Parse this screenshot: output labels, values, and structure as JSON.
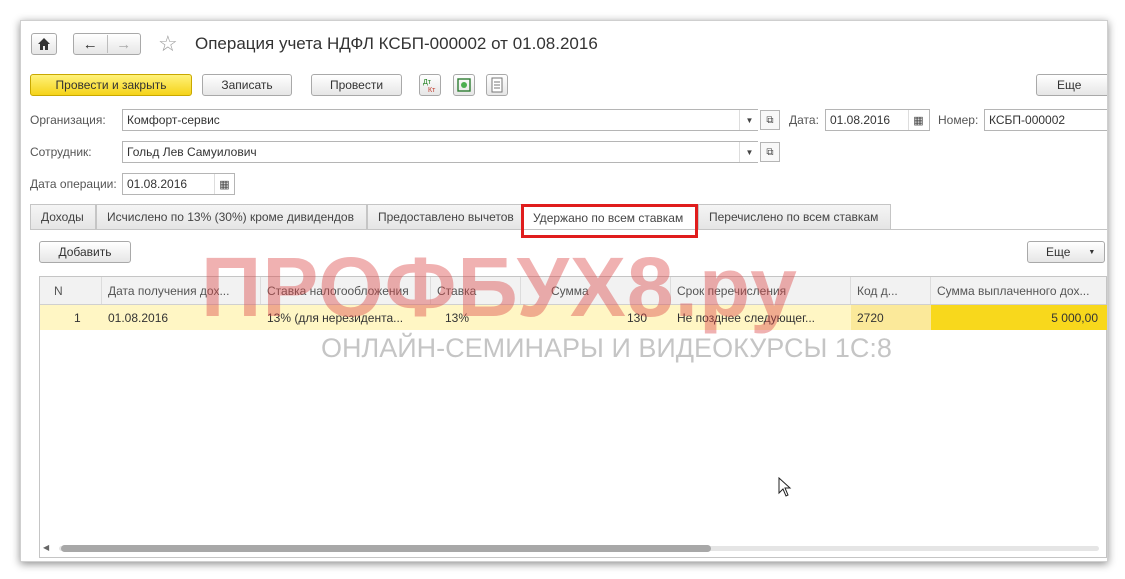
{
  "header": {
    "title": "Операция учета НДФЛ КСБП-000002 от 01.08.2016"
  },
  "toolbar": {
    "post_close": "Провести и закрыть",
    "save": "Записать",
    "post": "Провести",
    "more": "Еще"
  },
  "form": {
    "org_label": "Организация:",
    "org_value": "Комфорт-сервис",
    "date_label": "Дата:",
    "date_value": "01.08.2016",
    "number_label": "Номер:",
    "number_value": "КСБП-000002",
    "employee_label": "Сотрудник:",
    "employee_value": "Гольд Лев Самуилович",
    "op_date_label": "Дата операции:",
    "op_date_value": "01.08.2016"
  },
  "tabs": [
    "Доходы",
    "Исчислено по 13% (30%) кроме дивидендов",
    "Предоставлено вычетов",
    "Удержано по всем ставкам",
    "Перечислено по всем ставкам"
  ],
  "table_toolbar": {
    "add": "Добавить",
    "more": "Еще"
  },
  "table": {
    "columns": [
      "N",
      "Дата получения дох...",
      "Ставка налогообложения",
      "Ставка",
      "Сумма",
      "Срок перечисления",
      "Код д...",
      "Сумма выплаченного дох..."
    ],
    "rows": [
      {
        "n": "1",
        "date": "01.08.2016",
        "tax_rate": "13% (для нерезидента...",
        "rate": "13%",
        "sum": "130",
        "term": "Не позднее следующег...",
        "code": "2720",
        "paid": "5 000,00"
      }
    ]
  },
  "watermark": {
    "title": "ПРОФБУХ8.ру",
    "subtitle": "ОНЛАЙН-СЕМИНАРЫ И ВИДЕОКУРСЫ 1С:8"
  },
  "colors": {
    "accent_yellow": "#f5d31a",
    "row_highlight": "#fff6c4",
    "tab_highlight": "#e01d1d"
  }
}
